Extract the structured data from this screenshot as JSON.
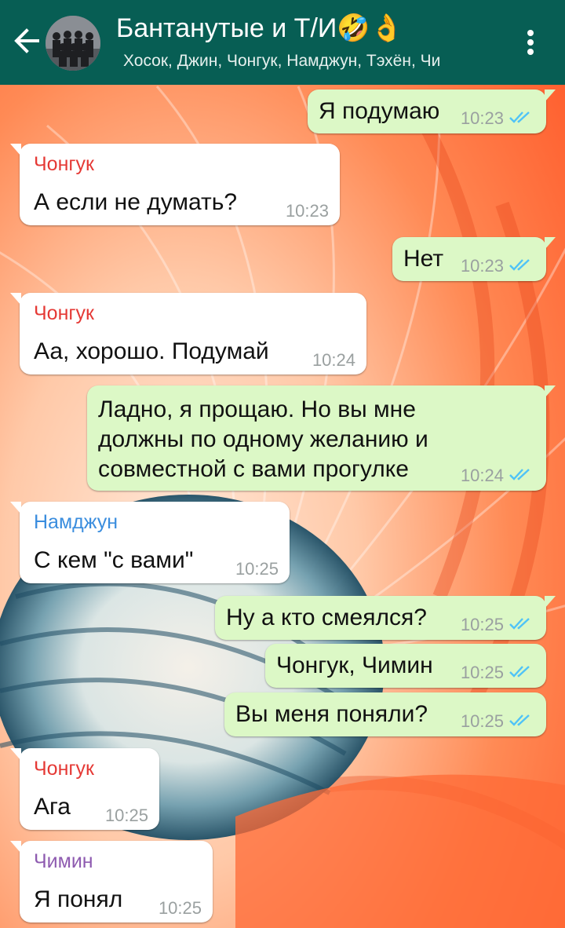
{
  "header": {
    "title": "Бантанутые и Т/И🤣👌",
    "subtitle": "Хосок, Джин, Чонгук, Намджун, Тэхён, Чи"
  },
  "colors": {
    "header": "#075E54",
    "outgoing_bubble": "#DCF8C6",
    "incoming_bubble": "#FFFFFF",
    "read_ticks": "#4FC3F7",
    "sender_jungkook": "#E53935",
    "sender_namjoon": "#3A8DDE",
    "sender_jimin": "#8E5BB0"
  },
  "messages": [
    {
      "text": "Я подумаю",
      "time": "10:23"
    },
    {
      "sender": "Чонгук",
      "text": "А если не думать?",
      "time": "10:23"
    },
    {
      "text": "Нет",
      "time": "10:23"
    },
    {
      "sender": "Чонгук",
      "text": "Аа, хорошо. Подумай",
      "time": "10:24"
    },
    {
      "lines": [
        "Ладно, я прощаю. Но вы мне",
        "должны по одному желанию и",
        "совместной с вами прогулке"
      ],
      "time": "10:24"
    },
    {
      "sender": "Намджун",
      "text": "С кем \"с вами\"",
      "time": "10:25"
    },
    {
      "text": "Ну а кто смеялся?",
      "time": "10:25"
    },
    {
      "text": "Чонгук, Чимин",
      "time": "10:25"
    },
    {
      "text": "Вы меня поняли?",
      "time": "10:25"
    },
    {
      "sender": "Чонгук",
      "text": "Ага",
      "time": "10:25"
    },
    {
      "sender": "Чимин",
      "text": "Я понял",
      "time": "10:25"
    }
  ]
}
